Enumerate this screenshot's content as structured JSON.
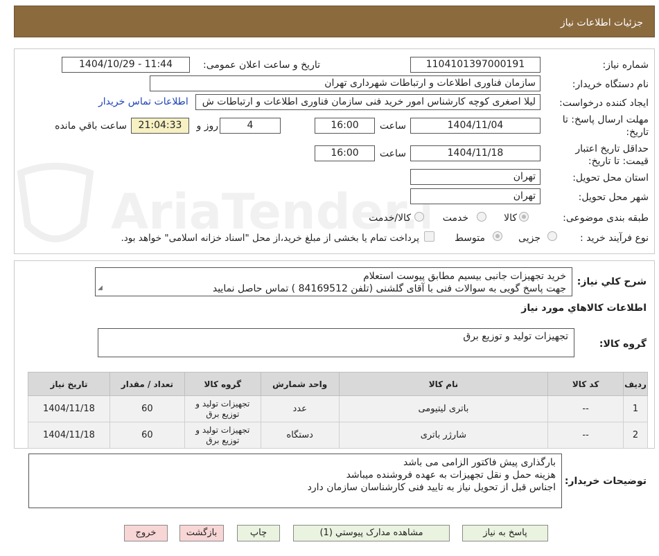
{
  "header": {
    "title": "جزئیات اطلاعات نیاز"
  },
  "watermark": {
    "text": "AriaTender.neT"
  },
  "info": {
    "need_number_label": "شماره نیاز:",
    "need_number": "1104101397000191",
    "announce_label": "تاریخ و ساعت اعلان عمومی:",
    "announce_value": "1404/10/29 - 11:44",
    "buyer_org_label": "نام دستگاه خریدار:",
    "buyer_org": "سازمان فناوری اطلاعات و ارتباطات شهرداری تهران",
    "creator_label": "ایجاد کننده درخواست:",
    "creator": "لیلا اصغری کوچه کارشناس امور خرید فنی سازمان فناوری اطلاعات و ارتباطات ش",
    "contact_link": "اطلاعات تماس خریدار",
    "deadline_label_1": "مهلت ارسال پاسخ: تا",
    "deadline_label_2": "تاریخ:",
    "deadline_date": "1404/11/04",
    "time_label": "ساعت",
    "deadline_time": "16:00",
    "days_value": "4",
    "days_label": "روز و",
    "remaining_time": "21:04:33",
    "remaining_label": "ساعت باقي مانده",
    "validity_label_1": "حداقل تاریخ اعتبار",
    "validity_label_2": "قیمت: تا تاریخ:",
    "validity_date": "1404/11/18",
    "validity_time": "16:00",
    "province_label": "استان محل تحویل:",
    "province": "تهران",
    "city_label": "شهر محل تحویل:",
    "city": "تهران",
    "category_label": "طبقه بندی موضوعی:",
    "category_options": [
      "کالا",
      "خدمت",
      "کالا/خدمت"
    ],
    "category_selected": "کالا",
    "process_label": "نوع فرآیند خرید :",
    "process_options": [
      "جزیی",
      "متوسط"
    ],
    "process_selected": "متوسط",
    "treasury_note": "پرداخت تمام یا بخشی از مبلغ خرید،از محل \"اسناد خزانه اسلامی\" خواهد بود."
  },
  "summary": {
    "label": "شرح كلي نياز:",
    "text": "خرید تجهیزات جانبی بیسیم مطابق پیوست استعلام\nجهت پاسخ گویی به سوالات فنی با آقای گلشنی (تلفن 84169512 ) تماس حاصل نمایید",
    "goods_info_title": "اطلاعات كالاهاي مورد نياز",
    "group_label": "گروه کالا:",
    "group_value": "تجهیزات تولید و توزیع برق"
  },
  "table": {
    "headers": [
      "ردیف",
      "کد کالا",
      "نام کالا",
      "واحد شمارش",
      "گروه کالا",
      "تعداد / مقدار",
      "تاریخ نیاز"
    ],
    "rows": [
      {
        "row": "1",
        "code": "--",
        "name": "باتری لیتیومی",
        "unit": "عدد",
        "group": "تجهیزات تولید و توزیع برق",
        "qty": "60",
        "date": "1404/11/18"
      },
      {
        "row": "2",
        "code": "--",
        "name": "شارژر باتری",
        "unit": "دستگاه",
        "group": "تجهیزات تولید و توزیع برق",
        "qty": "60",
        "date": "1404/11/18"
      }
    ]
  },
  "buyer_notes": {
    "label": "توضیحات خریدار:",
    "text": "بارگذاری پیش فاکتور الزامی می باشد\nهزینه حمل و نقل تجهیزات به عهده فروشنده میباشد\nاجناس قبل از تحویل نیاز به تایید فنی کارشناسان سازمان دارد"
  },
  "buttons": {
    "reply": "پاسخ به نیاز",
    "attachments": "مشاهده مدارک پیوستي (1)",
    "print": "چاپ",
    "back": "بازگشت",
    "exit": "خروج"
  }
}
